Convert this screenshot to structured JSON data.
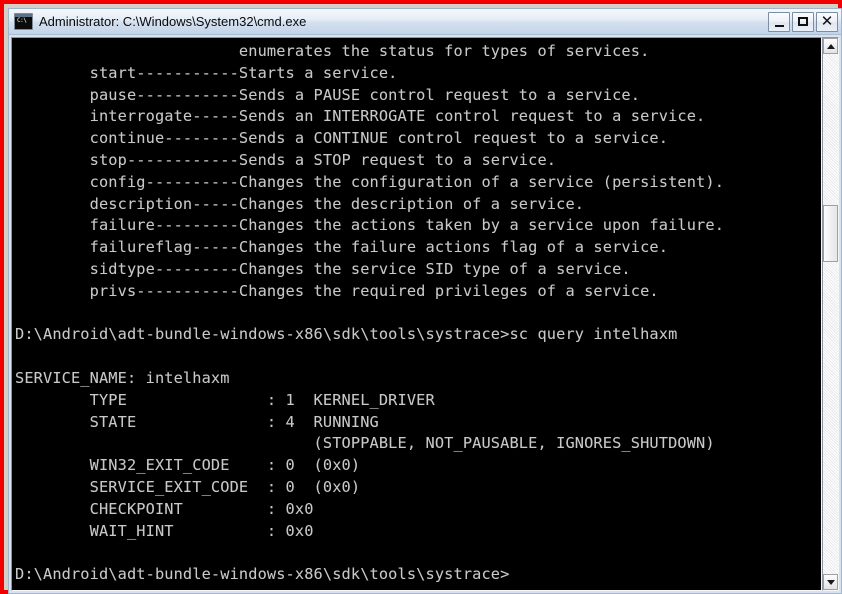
{
  "window": {
    "title": "Administrator: C:\\Windows\\System32\\cmd.exe",
    "icon_name": "cmd-console-icon",
    "icon_glyph": "C:\\",
    "annotation_border_color": "#f20000",
    "titlebar_color": "#d2dfee",
    "buttons": {
      "minimize_label": "_",
      "maximize_label": "□",
      "close_label": "✕"
    }
  },
  "console": {
    "background_color": "#000000",
    "text_color": "#c8c8c8",
    "lines": [
      "                        enumerates the status for types of services.",
      "        start-----------Starts a service.",
      "        pause-----------Sends a PAUSE control request to a service.",
      "        interrogate-----Sends an INTERROGATE control request to a service.",
      "        continue--------Sends a CONTINUE control request to a service.",
      "        stop------------Sends a STOP request to a service.",
      "        config----------Changes the configuration of a service (persistent).",
      "        description-----Changes the description of a service.",
      "        failure---------Changes the actions taken by a service upon failure.",
      "        failureflag-----Changes the failure actions flag of a service.",
      "        sidtype---------Changes the service SID type of a service.",
      "        privs-----------Changes the required privileges of a service.",
      "",
      "D:\\Android\\adt-bundle-windows-x86\\sdk\\tools\\systrace>sc query intelhaxm",
      "",
      "SERVICE_NAME: intelhaxm",
      "        TYPE               : 1  KERNEL_DRIVER",
      "        STATE              : 4  RUNNING",
      "                                (STOPPABLE, NOT_PAUSABLE, IGNORES_SHUTDOWN)",
      "        WIN32_EXIT_CODE    : 0  (0x0)",
      "        SERVICE_EXIT_CODE  : 0  (0x0)",
      "        CHECKPOINT         : 0x0",
      "        WAIT_HINT          : 0x0",
      "",
      "D:\\Android\\adt-bundle-windows-x86\\sdk\\tools\\systrace>"
    ],
    "current_directory": "D:\\Android\\adt-bundle-windows-x86\\sdk\\tools\\systrace",
    "last_command": "sc query intelhaxm",
    "service": {
      "name": "intelhaxm",
      "type_code": "1",
      "type_label": "KERNEL_DRIVER",
      "state_code": "4",
      "state_label": "RUNNING",
      "state_flags": "(STOPPABLE, NOT_PAUSABLE, IGNORES_SHUTDOWN)",
      "win32_exit_code": "0  (0x0)",
      "service_exit_code": "0  (0x0)",
      "checkpoint": "0x0",
      "wait_hint": "0x0"
    }
  },
  "scrollbar": {
    "up_arrow_name": "scroll-up-arrow",
    "down_arrow_name": "scroll-down-arrow",
    "thumb_top_pct": 29,
    "thumb_height_pct": 11
  }
}
